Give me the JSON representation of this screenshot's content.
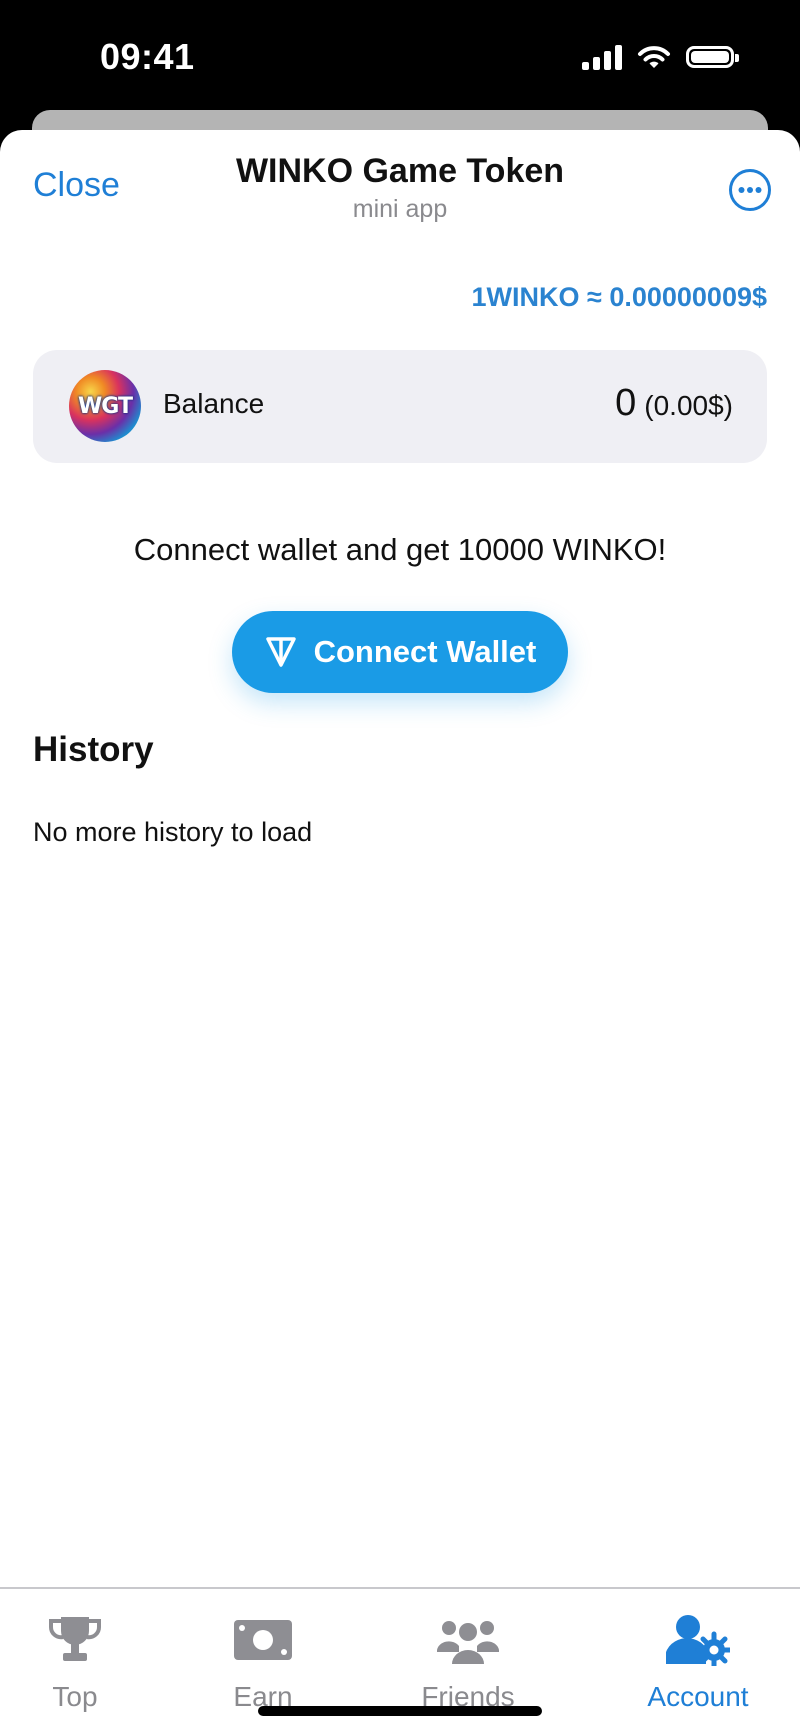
{
  "status_bar": {
    "time": "09:41"
  },
  "header": {
    "close_label": "Close",
    "title": "WINKO Game Token",
    "subtitle": "mini app"
  },
  "rate_text": "1WINKO ≈ 0.00000009$",
  "balance": {
    "label": "Balance",
    "amount": "0",
    "usd": "(0.00$)",
    "token_logo_text": "WGT"
  },
  "promo_text": "Connect wallet and get 10000 WINKO!",
  "connect_button": {
    "label": "Connect Wallet",
    "icon": "ton-icon"
  },
  "history": {
    "title": "History",
    "empty_text": "No more history to load"
  },
  "tabs": [
    {
      "label": "Top",
      "icon": "trophy-icon",
      "active": false
    },
    {
      "label": "Earn",
      "icon": "money-icon",
      "active": false
    },
    {
      "label": "Friends",
      "icon": "users-icon",
      "active": false
    },
    {
      "label": "Account",
      "icon": "user-gear-icon",
      "active": true
    }
  ],
  "colors": {
    "accent": "#1f7fd6",
    "button": "#1a9be6",
    "inactive": "#8a8a8e",
    "card_bg": "#efeff4"
  }
}
